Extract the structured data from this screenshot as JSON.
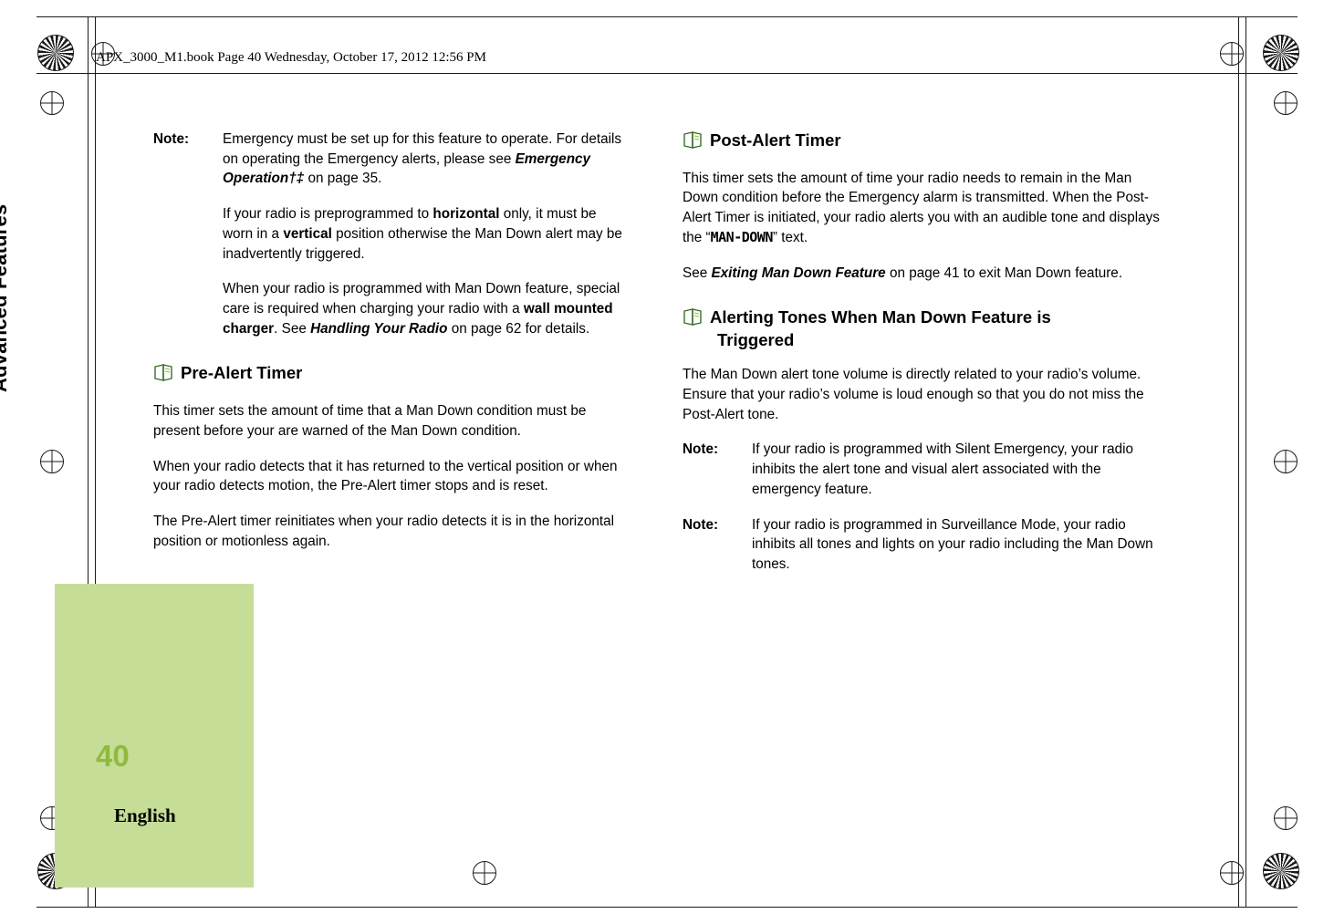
{
  "slug": "APX_3000_M1.book  Page 40  Wednesday, October 17, 2012  12:56 PM",
  "chapter": {
    "title": "Advanced Features",
    "page_number": "40",
    "language": "English",
    "tab_color": "#c6dd97",
    "page_number_color": "#8fba3f"
  },
  "icons": {
    "section_marker": "book-icon"
  },
  "left_column": {
    "note1": {
      "label": "Note:",
      "line1": "Emergency must be set up for this feature to operate. For details on operating the Emergency alerts, please see ",
      "ref_italic": "Emergency Operation†‡",
      "line2": " on page 35."
    },
    "note1_para2": {
      "t1": "If your radio is preprogrammed to ",
      "b1": "horizontal",
      "t2": " only, it must be worn in a ",
      "b2": "vertical",
      "t3": " position otherwise the Man Down alert may be inadvertently triggered."
    },
    "note1_para3": {
      "t1": "When your radio is programmed with Man Down feature, special care is required when charging your radio with a ",
      "b1": "wall mounted charger",
      "t2": ". See ",
      "bi1": "Handling Your Radio",
      "t3": " on page 62 for details."
    },
    "heading_pre_alert": "Pre-Alert Timer",
    "pre_alert_para1": "This timer sets the amount of time that a Man Down condition must be present before your are warned of the Man Down condition.",
    "pre_alert_para2": "When your radio detects that it has returned to the vertical position or when your radio detects motion, the Pre-Alert timer stops and is reset.",
    "pre_alert_para3": "The Pre-Alert timer reinitiates when your radio detects it is in the horizontal position or motionless again."
  },
  "right_column": {
    "heading_post_alert": "Post-Alert Timer",
    "post_alert_para1": {
      "t1": "This timer sets the amount of time your radio needs to remain in the Man Down condition before the Emergency alarm is transmitted. When the Post-Alert Timer is initiated, your radio alerts you with an audible tone and displays the “",
      "lcd": "MAN-DOWN",
      "t2": "” text."
    },
    "post_alert_para2": {
      "t1": "See ",
      "bi1": "Exiting Man Down Feature",
      "t2": " on page 41 to exit Man Down feature."
    },
    "heading_alerting_line1": "Alerting Tones When Man Down Feature is",
    "heading_alerting_line2": "Triggered",
    "alerting_para1": "The Man Down alert tone volume is directly related to your radio’s volume. Ensure that your radio’s volume is loud enough so that you do not miss the Post-Alert tone.",
    "note2": {
      "label": "Note:",
      "body": "If your radio is programmed with Silent Emergency, your radio inhibits the alert tone and visual alert associated with the emergency feature."
    },
    "note3": {
      "label": "Note:",
      "body": "If your radio is programmed in Surveillance Mode, your radio inhibits all tones and lights on your radio including the Man Down tones."
    }
  }
}
